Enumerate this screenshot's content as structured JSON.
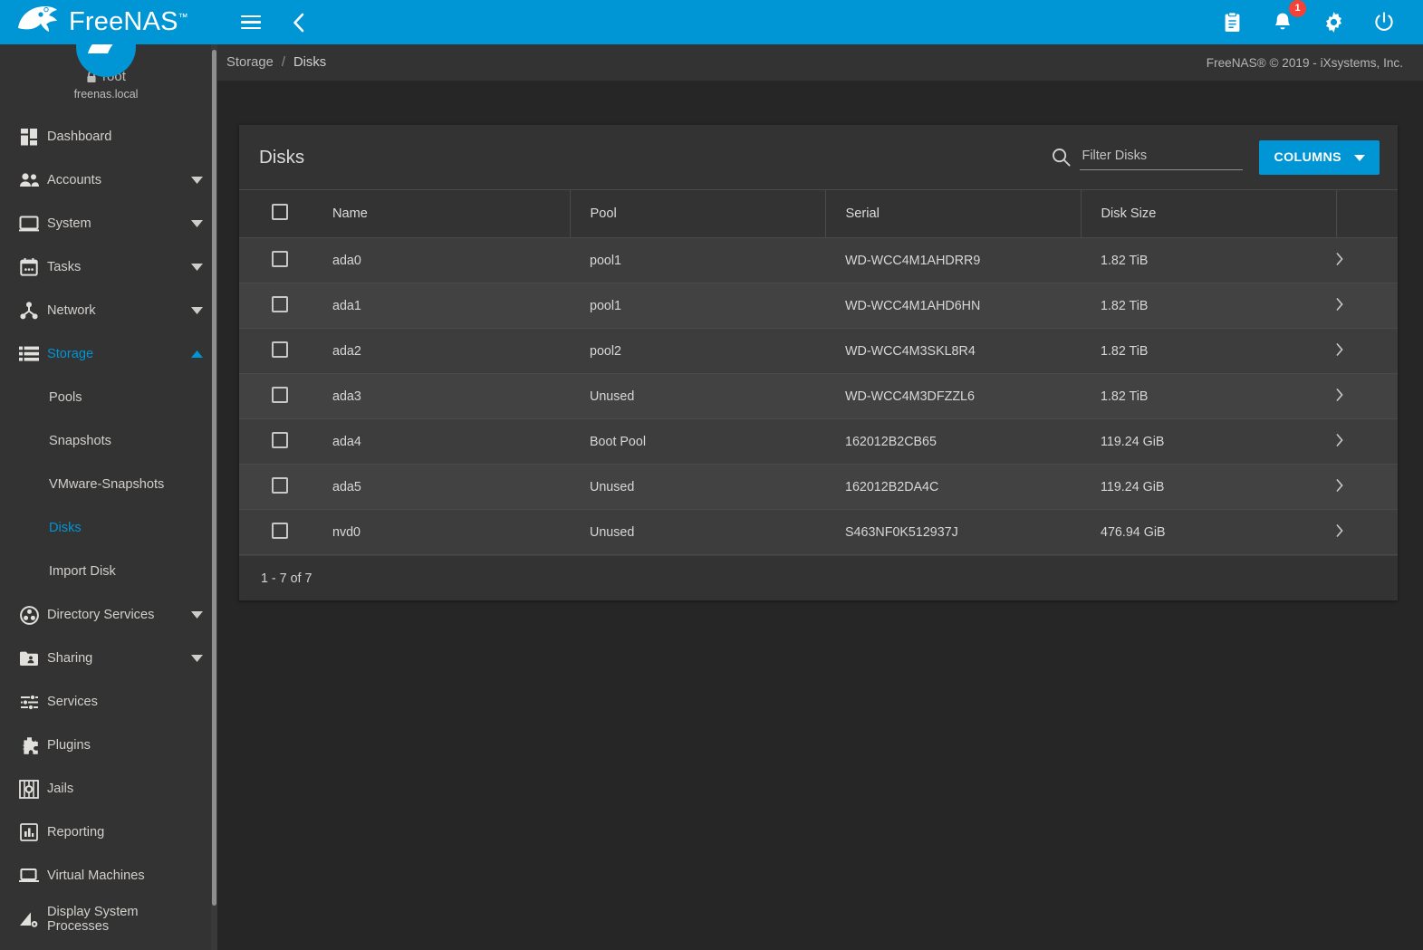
{
  "brand": {
    "name": "FreeNAS",
    "trademark": "™",
    "logo_icon": "freenas-shark-logo"
  },
  "topbar": {
    "menu_icon": "hamburger-menu-icon",
    "collapse_icon": "chevron-left-icon",
    "actions": [
      {
        "icon": "clipboard-tasks-icon",
        "name": "task-manager-button"
      },
      {
        "icon": "bell-notifications-icon",
        "name": "notifications-button",
        "badge": "1"
      },
      {
        "icon": "gear-settings-icon",
        "name": "settings-button"
      },
      {
        "icon": "power-icon",
        "name": "power-button"
      }
    ],
    "badge_color": "#f44336",
    "accent_color": "#0095d5"
  },
  "sidebar": {
    "user": {
      "name": "root",
      "host": "freenas.local",
      "lock_icon": "lock-icon"
    },
    "items": [
      {
        "label": "Dashboard",
        "icon": "dashboard-grid-icon",
        "expandable": false,
        "active": false
      },
      {
        "label": "Accounts",
        "icon": "people-icon",
        "expandable": true,
        "active": false
      },
      {
        "label": "System",
        "icon": "monitor-icon",
        "expandable": true,
        "active": false
      },
      {
        "label": "Tasks",
        "icon": "calendar-icon",
        "expandable": true,
        "active": false
      },
      {
        "label": "Network",
        "icon": "network-nodes-icon",
        "expandable": true,
        "active": false
      },
      {
        "label": "Storage",
        "icon": "storage-stack-icon",
        "expandable": true,
        "active": true,
        "expanded": true
      }
    ],
    "storage_children": [
      {
        "label": "Pools",
        "active": false
      },
      {
        "label": "Snapshots",
        "active": false
      },
      {
        "label": "VMware-Snapshots",
        "active": false
      },
      {
        "label": "Disks",
        "active": true
      },
      {
        "label": "Import Disk",
        "active": false
      }
    ],
    "items_after": [
      {
        "label": "Directory Services",
        "icon": "directory-services-icon",
        "expandable": true,
        "active": false
      },
      {
        "label": "Sharing",
        "icon": "folder-share-icon",
        "expandable": true,
        "active": false
      },
      {
        "label": "Services",
        "icon": "sliders-icon",
        "expandable": false,
        "active": false
      },
      {
        "label": "Plugins",
        "icon": "puzzle-piece-icon",
        "expandable": false,
        "active": false
      },
      {
        "label": "Jails",
        "icon": "jail-icon",
        "expandable": false,
        "active": false
      },
      {
        "label": "Reporting",
        "icon": "bar-chart-icon",
        "expandable": false,
        "active": false
      },
      {
        "label": "Virtual Machines",
        "icon": "laptop-icon",
        "expandable": false,
        "active": false
      },
      {
        "label": "Display System Processes",
        "icon": "processes-icon",
        "expandable": false,
        "active": false
      }
    ],
    "active_color": "#0095d5"
  },
  "breadcrumb": {
    "parent": "Storage",
    "separator": "/",
    "current": "Disks"
  },
  "copyright": "FreeNAS® © 2019 - iXsystems, Inc.",
  "card": {
    "title": "Disks",
    "search": {
      "placeholder": "Filter Disks",
      "value": "",
      "icon": "search-icon"
    },
    "columns_button": {
      "label": "COLUMNS",
      "icon": "chevron-down-icon",
      "color": "#0095d5"
    },
    "footer": "1 - 7 of 7"
  },
  "table": {
    "headers": [
      "Name",
      "Pool",
      "Serial",
      "Disk Size"
    ],
    "select_all_checked": false,
    "row_expand_icon": "chevron-right-icon",
    "rows": [
      {
        "name": "ada0",
        "pool": "pool1",
        "serial": "WD-WCC4M1AHDRR9",
        "size": "1.82 TiB",
        "checked": false
      },
      {
        "name": "ada1",
        "pool": "pool1",
        "serial": "WD-WCC4M1AHD6HN",
        "size": "1.82 TiB",
        "checked": false
      },
      {
        "name": "ada2",
        "pool": "pool2",
        "serial": "WD-WCC4M3SKL8R4",
        "size": "1.82 TiB",
        "checked": false
      },
      {
        "name": "ada3",
        "pool": "Unused",
        "serial": "WD-WCC4M3DFZZL6",
        "size": "1.82 TiB",
        "checked": false
      },
      {
        "name": "ada4",
        "pool": "Boot Pool",
        "serial": "162012B2CB65",
        "size": "119.24 GiB",
        "checked": false
      },
      {
        "name": "ada5",
        "pool": "Unused",
        "serial": "162012B2DA4C",
        "size": "119.24 GiB",
        "checked": false
      },
      {
        "name": "nvd0",
        "pool": "Unused",
        "serial": "S463NF0K512937J",
        "size": "476.94 GiB",
        "checked": false
      }
    ]
  }
}
